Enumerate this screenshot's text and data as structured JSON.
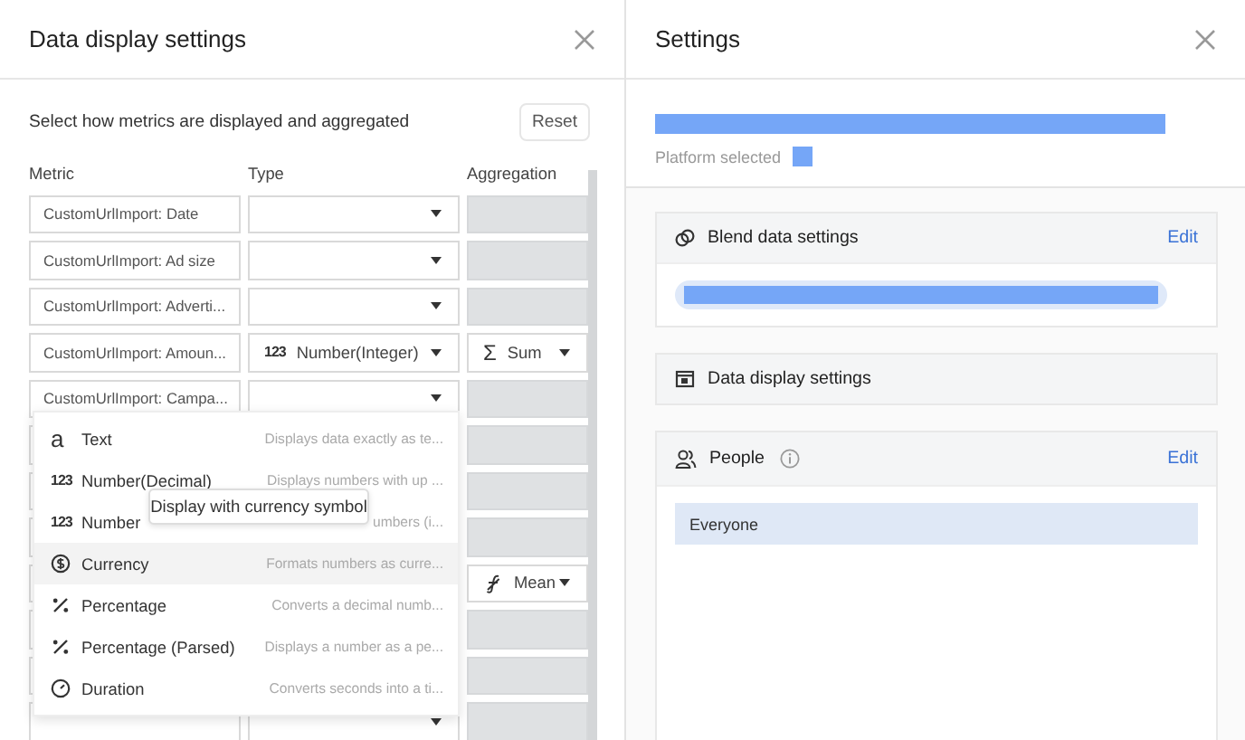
{
  "data_display_panel": {
    "title": "Data display settings",
    "intro": "Select how metrics are displayed and aggregated",
    "reset_button": "Reset",
    "columns": [
      "Metric",
      "Type",
      "Aggregation"
    ],
    "rows": [
      {
        "metric": "CustomUrlImport: Date",
        "aggregation_disabled": true
      },
      {
        "metric": "CustomUrlImport: Ad size",
        "aggregation_disabled": true
      },
      {
        "metric": "CustomUrlImport: Adverti...",
        "aggregation_disabled": true
      },
      {
        "metric": "CustomUrlImport: Amoun...",
        "type": {
          "glyph": "123",
          "label": "Number(Integer)"
        },
        "aggregation": {
          "kind": "sum",
          "glyph": "Σ",
          "label": "Sum"
        },
        "aggregation_disabled": false
      },
      {
        "metric": "CustomUrlImport: Campa...",
        "aggregation_disabled": true
      },
      {
        "aggregation_disabled": true
      },
      {
        "aggregation_disabled": true
      },
      {
        "aggregation_disabled": true
      },
      {
        "aggregation": {
          "kind": "function",
          "label": "Mean"
        },
        "aggregation_disabled": false
      },
      {
        "aggregation_disabled": true
      },
      {
        "aggregation_disabled": true
      },
      {
        "aggregation_disabled": true
      }
    ],
    "type_menu": [
      {
        "kind": "glyph",
        "glyph": "a",
        "label": "Text",
        "description": "Displays data exactly as te...",
        "selected": false
      },
      {
        "kind": "glyph",
        "glyph": "123",
        "label": "Number(Decimal)",
        "description": "Displays numbers with up ...",
        "selected": false
      },
      {
        "kind": "glyph",
        "glyph": "123",
        "label": "Number",
        "description": "umbers (i...",
        "selected": false
      },
      {
        "kind": "currency",
        "label": "Currency",
        "description": "Formats numbers as curre...",
        "selected": true
      },
      {
        "kind": "percentage",
        "label": "Percentage",
        "description": "Converts a decimal numb...",
        "selected": false
      },
      {
        "kind": "percentage",
        "label": "Percentage (Parsed)",
        "description": "Displays a number as a pe...",
        "selected": false
      },
      {
        "kind": "duration",
        "label": "Duration",
        "description": "Converts seconds into a ti...",
        "selected": false
      }
    ],
    "tooltip": "Display with currency symbol"
  },
  "settings_panel": {
    "title": "Settings",
    "platform_label": "Platform selected",
    "cards": [
      {
        "kind": "blend",
        "title": "Blend data settings",
        "edit": "Edit"
      },
      {
        "kind": "display",
        "title": "Data display settings"
      },
      {
        "kind": "people",
        "title": "People",
        "info": true,
        "edit": "Edit",
        "items": [
          {
            "label": "Everyone",
            "selected": true
          }
        ]
      }
    ]
  }
}
